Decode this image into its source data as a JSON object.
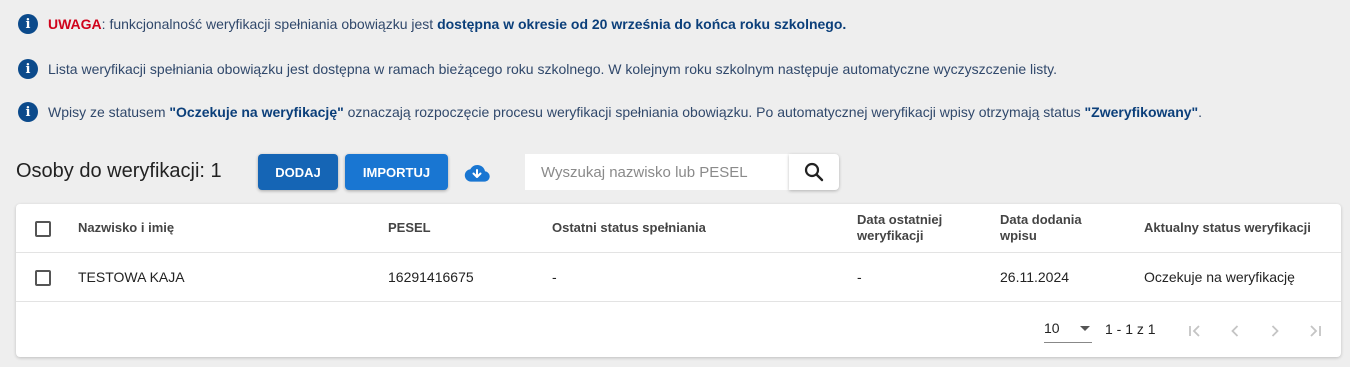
{
  "notices": [
    {
      "prefix": "UWAGA",
      "text": ": funkcjonalność weryfikacji spełniania obowiązku jest ",
      "bold": "dostępna w okresie od 20 września do końca roku szkolnego."
    },
    {
      "text": "Lista weryfikacji spełniania obowiązku jest dostępna w ramach bieżącego roku szkolnego. W kolejnym roku szkolnym następuje automatyczne wyczyszczenie listy."
    },
    {
      "text_a": "Wpisy ze statusem ",
      "bold_a": "\"Oczekuje na weryfikację\"",
      "text_b": " oznaczają rozpoczęcie procesu weryfikacji spełniania obowiązku. Po automatycznej weryfikacji wpisy otrzymają status ",
      "bold_b": "\"Zweryfikowany\"",
      "text_c": "."
    }
  ],
  "toolbar": {
    "title": "Osoby do weryfikacji: 1",
    "add_label": "DODAJ",
    "import_label": "IMPORTUJ",
    "download_icon": "cloud-download-icon",
    "search_placeholder": "Wyszukaj nazwisko lub PESEL",
    "search_value": ""
  },
  "table": {
    "columns": {
      "name": "Nazwisko i imię",
      "pesel": "PESEL",
      "last_status": "Ostatni status spełniania",
      "last_verification_1": "Data ostatniej",
      "last_verification_2": "weryfikacji",
      "date_added_1": "Data dodania",
      "date_added_2": "wpisu",
      "current_status": "Aktualny status weryfikacji"
    },
    "rows": [
      {
        "name": "TESTOWA KAJA",
        "pesel": "16291416675",
        "last_status": "-",
        "last_verification": "-",
        "date_added": "26.11.2024",
        "current_status": "Oczekuje na weryfikację"
      }
    ]
  },
  "paginator": {
    "page_size": "10",
    "range": "1 - 1 z 1"
  },
  "colors": {
    "primary": "#1976d2",
    "notice_icon": "#0b4a8b",
    "warning": "#d0021b"
  }
}
